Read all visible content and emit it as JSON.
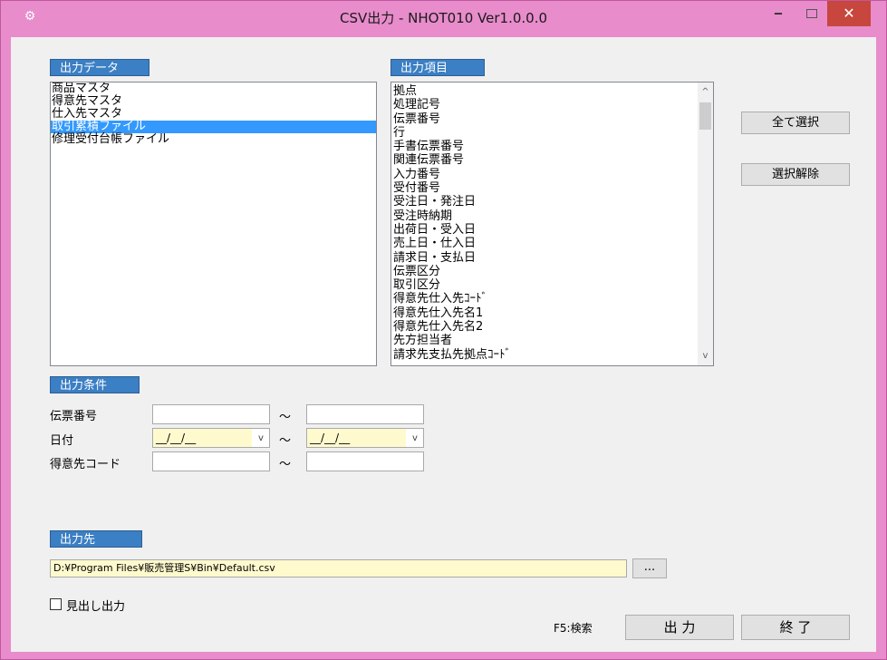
{
  "window": {
    "title": "CSV出力 - NHOT010 Ver1.0.0.0",
    "icon": "app-icon",
    "controls": {
      "minimize": "‒",
      "maximize": "□",
      "close": "✕"
    },
    "colors": {
      "frame": "#e88ccb",
      "close": "#c7463d",
      "section_header": "#3b7fc4",
      "selection": "#3399ff",
      "highlight_input": "#fffacd"
    }
  },
  "output_data": {
    "header": "出力データ",
    "items": [
      {
        "label": "商品マスタ",
        "selected": false
      },
      {
        "label": "得意先マスタ",
        "selected": false
      },
      {
        "label": "仕入先マスタ",
        "selected": false
      },
      {
        "label": "取引累積ファイル",
        "selected": true
      },
      {
        "label": "修理受付台帳ファイル",
        "selected": false
      }
    ]
  },
  "output_items": {
    "header": "出力項目",
    "items": [
      "拠点",
      "処理記号",
      "伝票番号",
      "行",
      "手書伝票番号",
      "関連伝票番号",
      "入力番号",
      "受付番号",
      "受注日・発注日",
      "受注時納期",
      "出荷日・受入日",
      "売上日・仕入日",
      "請求日・支払日",
      "伝票区分",
      "取引区分",
      "得意先仕入先ｺｰﾄﾞ",
      "得意先仕入先名1",
      "得意先仕入先名2",
      "先方担当者",
      "請求先支払先拠点ｺｰﾄﾞ"
    ],
    "scroll_up": "^",
    "scroll_down": "v"
  },
  "actions": {
    "select_all": "全て選択",
    "deselect": "選択解除"
  },
  "conditions": {
    "header": "出力条件",
    "slip_number": {
      "label": "伝票番号",
      "from": "",
      "to": ""
    },
    "date": {
      "label": "日付",
      "from": "__/__/__",
      "to": "__/__/__",
      "dropdown": "v"
    },
    "customer_code": {
      "label": "得意先コード",
      "from": "",
      "to": ""
    },
    "range_sep": "～"
  },
  "destination": {
    "header": "出力先",
    "path": "D:¥Program Files¥販売管理S¥Bin¥Default.csv",
    "browse": "..."
  },
  "options": {
    "heading_output": {
      "label": "見出し出力",
      "checked": false
    }
  },
  "footer": {
    "hint": "F5:検索",
    "output_button": "出 力",
    "exit_button": "終 了"
  }
}
